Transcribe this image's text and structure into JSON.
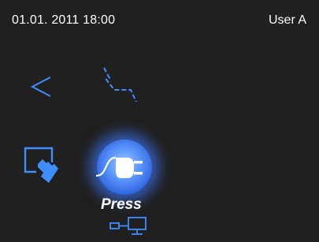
{
  "status_bar": {
    "datetime": "01.01. 2011 18:00",
    "user": "User A"
  },
  "icons": {
    "back": "chevron-left-icon",
    "trend": "trend-line-icon",
    "touch": "touch-screen-icon",
    "plug": "power-plug-icon",
    "network": "network-connection-icon"
  },
  "plug_button": {
    "label": "Press"
  },
  "colors": {
    "background": "#202020",
    "icon_blue": "#3f8dff",
    "glow_blue": "#5f9bff",
    "text": "#ffffff"
  }
}
